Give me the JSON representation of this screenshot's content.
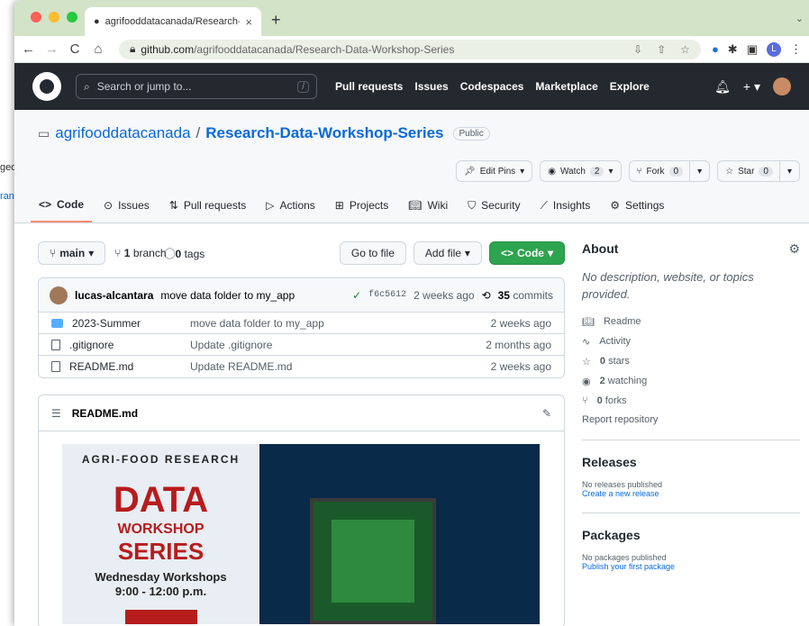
{
  "background_window": {
    "text1": "ged",
    "text2": "ran"
  },
  "browser": {
    "tab_title": "agrifooddatacanada/Research-",
    "address_host": "github.com",
    "address_path": "/agrifooddatacanada/Research-Data-Workshop-Series",
    "profile_initial": "L"
  },
  "github": {
    "search_placeholder": "Search or jump to...",
    "search_key": "/",
    "nav": [
      "Pull requests",
      "Issues",
      "Codespaces",
      "Marketplace",
      "Explore"
    ]
  },
  "repo": {
    "owner": "agrifooddatacanada",
    "separator": "/",
    "name": "Research-Data-Workshop-Series",
    "visibility": "Public",
    "edit_pins": "Edit Pins",
    "watch_label": "Watch",
    "watch_count": "2",
    "fork_label": "Fork",
    "fork_count": "0",
    "star_label": "Star",
    "star_count": "0",
    "tabs": [
      "Code",
      "Issues",
      "Pull requests",
      "Actions",
      "Projects",
      "Wiki",
      "Security",
      "Insights",
      "Settings"
    ]
  },
  "toolbar": {
    "branch": "main",
    "branches_count": "1",
    "branches_label": "branch",
    "tags_count": "0",
    "tags_label": "tags",
    "go_to_file": "Go to file",
    "add_file": "Add file",
    "code": "Code"
  },
  "commit": {
    "author": "lucas-alcantara",
    "message": "move data folder to my_app",
    "sha": "f6c5612",
    "time": "2 weeks ago",
    "commits_count": "35",
    "commits_label": "commits"
  },
  "files": [
    {
      "name": "2023-Summer",
      "message": "move data folder to my_app",
      "time": "2 weeks ago"
    },
    {
      "name": ".gitignore",
      "message": "Update .gitignore",
      "time": "2 months ago"
    },
    {
      "name": "README.md",
      "message": "Update README.md",
      "time": "2 weeks ago"
    }
  ],
  "readme": {
    "title": "README.md",
    "banner_line1": "AGRI-FOOD RESEARCH",
    "banner_line2": "DATA",
    "banner_line3": "WORKSHOP",
    "banner_line4": "SERIES",
    "banner_line5": "Wednesday Workshops",
    "banner_line6": "9:00 - 12:00 p.m."
  },
  "about": {
    "title": "About",
    "description": "No description, website, or topics provided.",
    "readme": "Readme",
    "activity": "Activity",
    "stars_count": "0",
    "stars_label": "stars",
    "watching_count": "2",
    "watching_label": "watching",
    "forks_count": "0",
    "forks_label": "forks",
    "report": "Report repository"
  },
  "releases": {
    "title": "Releases",
    "none": "No releases published",
    "create": "Create a new release"
  },
  "packages": {
    "title": "Packages",
    "none": "No packages published",
    "publish": "Publish your first package"
  },
  "colors": {
    "accent": "#0969da",
    "green": "#2da44e",
    "header": "#24292f"
  }
}
